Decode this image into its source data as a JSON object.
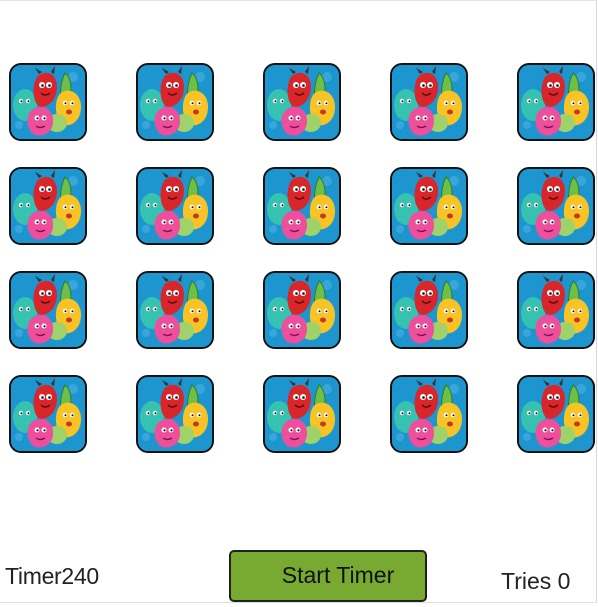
{
  "game": {
    "timer_label": "Timer",
    "timer_value": "240",
    "start_button_label": "Start Timer",
    "tries_label": "Tries",
    "tries_value": "0"
  },
  "board": {
    "rows": 4,
    "columns": 5,
    "cards": [
      {
        "state": "face-down"
      },
      {
        "state": "face-down"
      },
      {
        "state": "face-down"
      },
      {
        "state": "face-down"
      },
      {
        "state": "face-down"
      },
      {
        "state": "face-down"
      },
      {
        "state": "face-down"
      },
      {
        "state": "face-down"
      },
      {
        "state": "face-down"
      },
      {
        "state": "face-down"
      },
      {
        "state": "face-down"
      },
      {
        "state": "face-down"
      },
      {
        "state": "face-down"
      },
      {
        "state": "face-down"
      },
      {
        "state": "face-down"
      },
      {
        "state": "face-down"
      },
      {
        "state": "face-down"
      },
      {
        "state": "face-down"
      },
      {
        "state": "face-down"
      },
      {
        "state": "face-down"
      }
    ],
    "card_back_icon": "cartoon-monsters-icon"
  },
  "colors": {
    "card_background": "#1d95cf",
    "button_background": "#78a931",
    "card_border": "#121212"
  }
}
